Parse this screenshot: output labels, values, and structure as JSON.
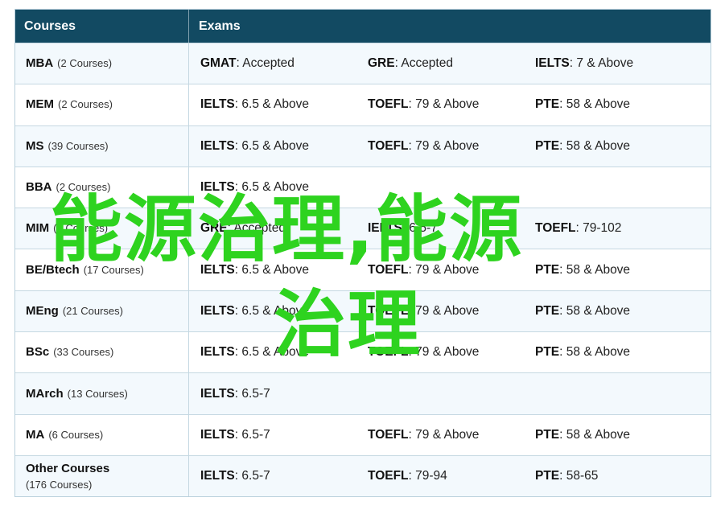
{
  "header": {
    "courses": "Courses",
    "exams": "Exams"
  },
  "rows": [
    {
      "name": "MBA",
      "count": "(2 Courses)",
      "exams": [
        {
          "n": "GMAT",
          "v": ": Accepted"
        },
        {
          "n": "GRE",
          "v": ": Accepted"
        },
        {
          "n": "IELTS",
          "v": ": 7 & Above"
        }
      ]
    },
    {
      "name": "MEM",
      "count": "(2 Courses)",
      "exams": [
        {
          "n": "IELTS",
          "v": ": 6.5 & Above"
        },
        {
          "n": "TOEFL",
          "v": ": 79 & Above"
        },
        {
          "n": "PTE",
          "v": ": 58 & Above"
        }
      ]
    },
    {
      "name": "MS",
      "count": "(39 Courses)",
      "exams": [
        {
          "n": "IELTS",
          "v": ": 6.5 & Above"
        },
        {
          "n": "TOEFL",
          "v": ": 79 & Above"
        },
        {
          "n": "PTE",
          "v": ": 58 & Above"
        }
      ]
    },
    {
      "name": "BBA",
      "count": "(2 Courses)",
      "exams": [
        {
          "n": "IELTS",
          "v": ": 6.5 & Above"
        },
        {
          "n": "",
          "v": ""
        },
        {
          "n": "",
          "v": ""
        }
      ]
    },
    {
      "name": "MIM",
      "count": "(2 Courses)",
      "exams": [
        {
          "n": "GRE",
          "v": ": Accepted"
        },
        {
          "n": "IELTS",
          "v": ": 6.5-7"
        },
        {
          "n": "TOEFL",
          "v": ": 79-102"
        }
      ]
    },
    {
      "name": "BE/Btech",
      "count": "(17 Courses)",
      "exams": [
        {
          "n": "IELTS",
          "v": ": 6.5 & Above"
        },
        {
          "n": "TOEFL",
          "v": ": 79 & Above"
        },
        {
          "n": "PTE",
          "v": ": 58 & Above"
        }
      ]
    },
    {
      "name": "MEng",
      "count": "(21 Courses)",
      "exams": [
        {
          "n": "IELTS",
          "v": ": 6.5 & Above"
        },
        {
          "n": "TOEFL",
          "v": ": 79 & Above"
        },
        {
          "n": "PTE",
          "v": ": 58 & Above"
        }
      ]
    },
    {
      "name": "BSc",
      "count": "(33 Courses)",
      "exams": [
        {
          "n": "IELTS",
          "v": ": 6.5 & Above"
        },
        {
          "n": "TOEFL",
          "v": ": 79 & Above"
        },
        {
          "n": "PTE",
          "v": ": 58 & Above"
        }
      ]
    },
    {
      "name": "MArch",
      "count": "(13 Courses)",
      "exams": [
        {
          "n": "IELTS",
          "v": ": 6.5-7"
        },
        {
          "n": "",
          "v": ""
        },
        {
          "n": "",
          "v": ""
        }
      ]
    },
    {
      "name": "MA",
      "count": "(6 Courses)",
      "exams": [
        {
          "n": "IELTS",
          "v": ": 6.5-7"
        },
        {
          "n": "TOEFL",
          "v": ": 79 & Above"
        },
        {
          "n": "PTE",
          "v": ": 58 & Above"
        }
      ]
    },
    {
      "name": "Other Courses",
      "count": "(176 Courses)",
      "exams": [
        {
          "n": "IELTS",
          "v": ": 6.5-7"
        },
        {
          "n": "TOEFL",
          "v": ": 79-94"
        },
        {
          "n": "PTE",
          "v": ": 58-65"
        }
      ]
    }
  ],
  "watermark": {
    "line1": "能源治理,能源",
    "line2": "治理"
  },
  "colors": {
    "header_bg": "#124a62",
    "watermark": "#2ed31f"
  }
}
